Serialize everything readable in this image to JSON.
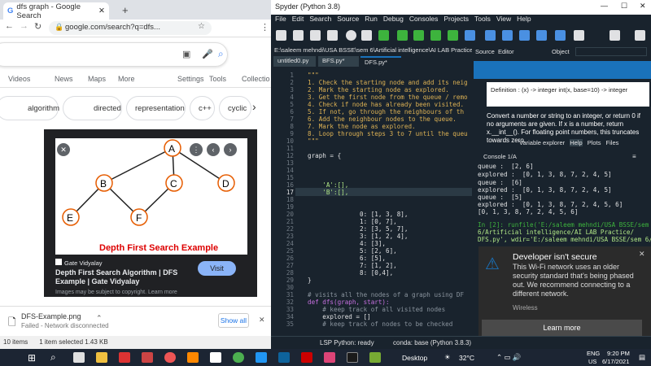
{
  "chrome": {
    "tab_title": "dfs graph - Google Search",
    "url": "google.com/search?q=dfs...",
    "search_tabs": [
      "Videos",
      "News",
      "Maps",
      "More",
      "Settings",
      "Tools",
      "Collectio"
    ],
    "chips": [
      "algorithm",
      "directed",
      "representation",
      "c++",
      "cyclic"
    ],
    "image_source": "Gate Vidyalay",
    "image_title": "Depth First Search Algorithm | DFS Example | Gate Vidyalay",
    "visit_label": "Visit",
    "copyright": "Images may be subject to copyright. Learn more",
    "diagram_caption": "Depth First Search Example",
    "nodes": [
      "A",
      "B",
      "C",
      "D",
      "E",
      "F"
    ],
    "download_name": "DFS-Example.png",
    "download_status": "Failed - Network disconnected",
    "show_all": "Show all",
    "status_items": "10 items",
    "status_selected": "1 item selected  1.43 KB"
  },
  "spyder": {
    "title": "Spyder (Python 3.8)",
    "menu": [
      "File",
      "Edit",
      "Search",
      "Source",
      "Run",
      "Debug",
      "Consoles",
      "Projects",
      "Tools",
      "View",
      "Help"
    ],
    "path": "E:\\saleem mehndi\\USA BSSE\\sem 6\\Artificial intelligence\\AI LAB Practice\\DFS.py",
    "tabs": [
      "untitled0.py",
      "BFS.py*",
      "DFS.py*"
    ],
    "line_numbers": [
      "1",
      "2",
      "3",
      "4",
      "5",
      "6",
      "7",
      "8",
      "9",
      "10",
      "11",
      "12",
      "13",
      "14",
      "15",
      "16",
      "17",
      "18",
      "19",
      "20",
      "21",
      "22",
      "23",
      "24",
      "25",
      "26",
      "27",
      "28",
      "29",
      "30",
      "31",
      "32",
      "33",
      "34",
      "35"
    ],
    "code": [
      "\"\"\"",
      "1. Check the starting node and add its neig",
      "2. Mark the starting node as explored.",
      "3. Get the first node from the queue / remo",
      "4. Check if node has already been visited.",
      "5. If not, go through the neighbours of th",
      "6. Add the neighbour nodes to the queue.",
      "7. Mark the node as explored.",
      "8. Loop through steps 3 to 7 until the queu",
      "\"\"\"",
      "",
      "graph = {",
      "",
      "",
      "",
      "    'A':[],",
      "    'B':[],",
      "",
      "",
      "",
      "              0: [1, 3, 8],",
      "              1: [0, 7],",
      "              2: [3, 5, 7],",
      "              3: [1, 2, 4],",
      "              4: [3],",
      "              5: [2, 6],",
      "              6: [5],",
      "              7: [1, 2],",
      "              8: [0,4],",
      "}",
      "",
      "# visits all the nodes of a graph using DF",
      "def dfs(graph, start):",
      "    # keep track of all visited nodes",
      "    explored = []",
      "    # keep track of nodes to be checked"
    ],
    "help_source_label": "Source",
    "help_source_value": "Editor",
    "help_object_label": "Object",
    "definition": "Definition : (x) -> integer int(x, base=10) -> integer",
    "help_text": "Convert a number or string to an integer, or return 0 if no arguments are given. If x is a number, return x.__int__(). For floating point numbers, this truncates towards zero.",
    "help_tabs": [
      "Variable explorer",
      "Help",
      "Plots",
      "Files"
    ],
    "console_tab": "Console 1/A",
    "console_lines": [
      "queue :  [2, 6]",
      "explored :  [0, 1, 3, 8, 7, 2, 4, 5]",
      "queue :  [6]",
      "explored :  [0, 1, 3, 8, 7, 2, 4, 5]",
      "queue :  [5]",
      "explored :  [0, 1, 3, 8, 7, 2, 4, 5, 6]",
      "[0, 1, 3, 8, 7, 2, 4, 5, 6]",
      "",
      "In [2]: runfile('E:/saleem mehndi/USA BSSE/sem",
      "6/Artificial intelligence/AI LAB Practice/",
      "DFS.py', wdir='E:/saleem mehndi/USA BSSE/sem 6/"
    ],
    "status_lsp": "LSP Python: ready",
    "status_conda": "conda: base (Python 3.8.3)"
  },
  "toast": {
    "title": "Developer isn't secure",
    "body": "This Wi-Fi network uses an older security standard that's being phased out. We recommend connecting to a different network.",
    "sub": "Wireless",
    "button": "Learn more"
  },
  "taskbar": {
    "desktop": "Desktop",
    "temp": "32°C",
    "lang": "ENG",
    "region": "US",
    "time": "9:20 PM",
    "date": "6/17/2021"
  }
}
